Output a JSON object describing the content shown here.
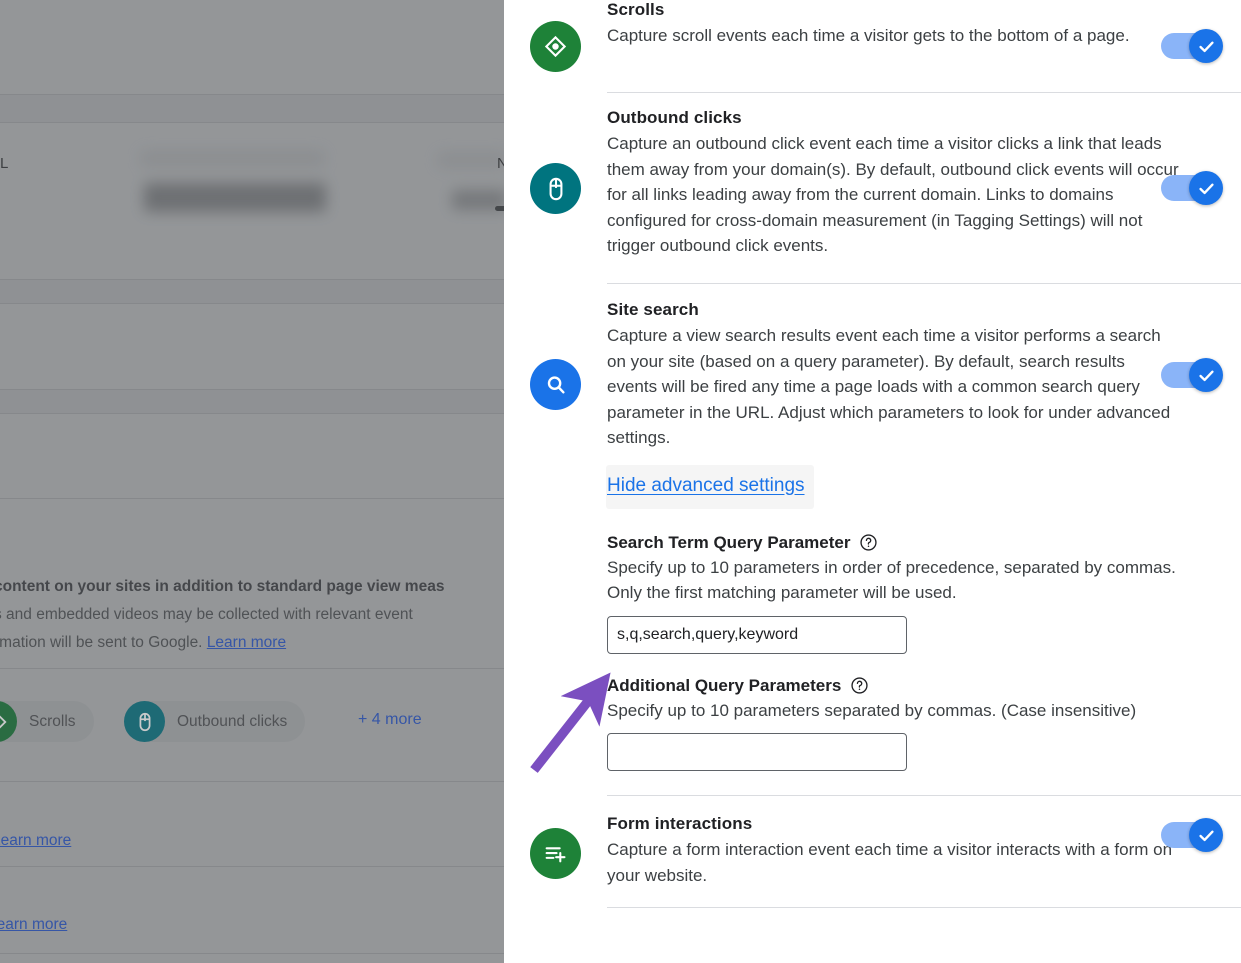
{
  "backdrop": {
    "paragraph_fragments": [
      "content on your sites in addition to standard page view meas",
      "s and embedded videos may be collected with relevant event",
      "rmation will be sent to Google."
    ],
    "learn_more_label": "Learn more",
    "chips": [
      {
        "label": "Scrolls",
        "icon": "scrolls-icon",
        "color": "#137333"
      },
      {
        "label": "Outbound clicks",
        "icon": "mouse-click-icon",
        "color": "#00707f"
      }
    ],
    "more_label": "+ 4 more",
    "link_rows": [
      "Learn more",
      "Learn more"
    ],
    "edge_fragments": [
      "L",
      "N"
    ]
  },
  "panel": {
    "sections": [
      {
        "id": "scrolls",
        "title": "Scrolls",
        "description": "Capture scroll events each time a visitor gets to the bottom of a page.",
        "icon": "scrolls-icon",
        "icon_color": "#1e8238",
        "toggle_on": true
      },
      {
        "id": "outbound-clicks",
        "title": "Outbound clicks",
        "description": "Capture an outbound click event each time a visitor clicks a link that leads them away from your domain(s). By default, outbound click events will occur for all links leading away from the current domain. Links to domains configured for cross-domain measurement (in Tagging Settings) will not trigger outbound click events.",
        "icon": "mouse-click-icon",
        "icon_color": "#00747f",
        "toggle_on": true
      },
      {
        "id": "site-search",
        "title": "Site search",
        "description": "Capture a view search results event each time a visitor performs a search on your site (based on a query parameter). By default, search results events will be fired any time a page loads with a common search query parameter in the URL. Adjust which parameters to look for under advanced settings.",
        "icon": "search-icon",
        "icon_color": "#1a73e8",
        "toggle_on": true,
        "advanced_toggle_label": "Hide advanced settings"
      },
      {
        "id": "form-interactions",
        "title": "Form interactions",
        "description": "Capture a form interaction event each time a visitor interacts with a form on your website.",
        "icon": "form-add-icon",
        "icon_color": "#1e8238",
        "toggle_on": true
      }
    ],
    "advanced": {
      "search_term": {
        "label": "Search Term Query Parameter",
        "help_icon": "help-circle-icon",
        "description": "Specify up to 10 parameters in order of precedence, separated by commas. Only the first matching parameter will be used.",
        "value": "s,q,search,query,keyword",
        "placeholder": ""
      },
      "additional_params": {
        "label": "Additional Query Parameters",
        "help_icon": "help-circle-icon",
        "description": "Specify up to 10 parameters separated by commas. (Case insensitive)",
        "value": "",
        "placeholder": ""
      }
    }
  },
  "annotation": {
    "type": "arrow",
    "color": "#7b4fc0",
    "points_to": "search-term-input"
  },
  "colors": {
    "accent_blue": "#1a73e8",
    "toggle_track": "#8ab4f8",
    "link_blue": "#1a73e8",
    "divider": "#dadce0",
    "text_primary": "#202124",
    "text_secondary": "#3c4043",
    "annotation_purple": "#7b4fc0"
  }
}
